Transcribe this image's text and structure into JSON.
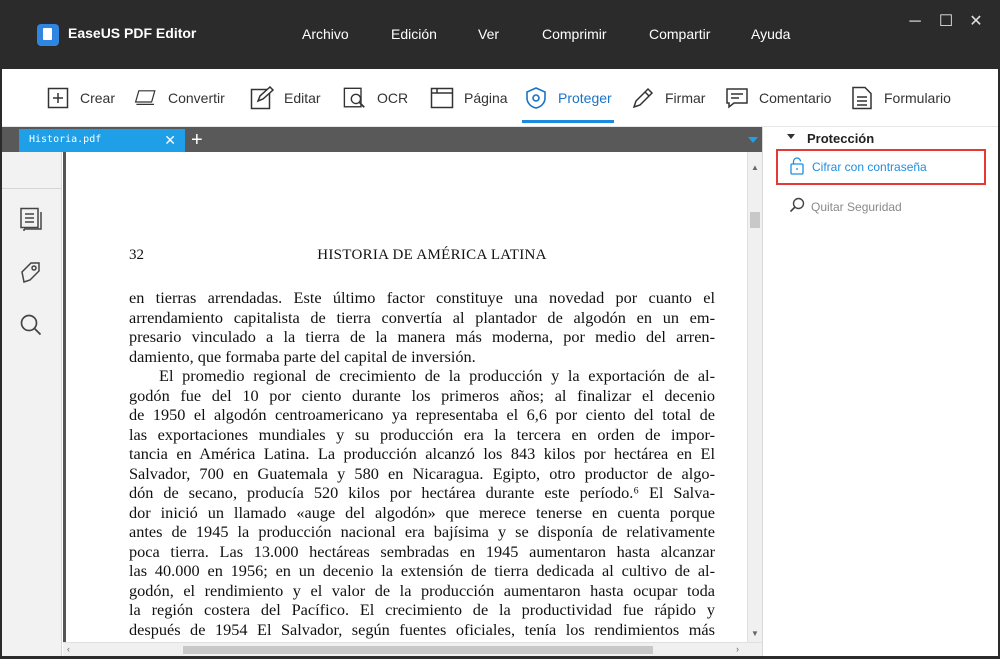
{
  "app": {
    "title": "EaseUS PDF Editor",
    "menu": [
      "Archivo",
      "Edición",
      "Ver",
      "Comprimir",
      "Compartir",
      "Ayuda"
    ],
    "window_controls": {
      "minimize": "─",
      "maximize": "☐",
      "close": "✕"
    }
  },
  "toolbar": {
    "items": [
      {
        "label": "Crear",
        "icon": "plus-box-icon"
      },
      {
        "label": "Convertir",
        "icon": "convert-icon"
      },
      {
        "label": "Editar",
        "icon": "edit-icon"
      },
      {
        "label": "OCR",
        "icon": "ocr-icon"
      },
      {
        "label": "Página",
        "icon": "page-icon"
      },
      {
        "label": "Proteger",
        "icon": "shield-icon",
        "active": true
      },
      {
        "label": "Firmar",
        "icon": "pen-icon"
      },
      {
        "label": "Comentario",
        "icon": "comment-icon"
      },
      {
        "label": "Formulario",
        "icon": "form-icon"
      }
    ],
    "accent_color": "#1a8be0"
  },
  "tabs": {
    "items": [
      {
        "label": "Historia.pdf",
        "close": "✕"
      }
    ],
    "new_tab": "+"
  },
  "left_rail": {
    "icons": [
      "thumbnails-icon",
      "bookmark-icon",
      "search-icon"
    ]
  },
  "document": {
    "page_number": "32",
    "running_head": "HISTORIA DE AMÉRICA LATINA",
    "lines": [
      "en tierras arrendadas. Este último factor constituye una novedad por cuanto el",
      "arrendamiento capitalista de tierra convertía al plantador de algodón en un em-",
      "presario vinculado a la tierra de la manera más moderna, por medio del arren-",
      "damiento, que formaba parte del capital de inversión.",
      "El promedio regional de crecimiento de la producción y la exportación de al-",
      "godón fue del 10 por ciento durante los primeros años; al finalizar el decenio",
      "de 1950 el algodón centroamericano ya representaba el 6,6 por ciento del total de",
      "las exportaciones mundiales y su producción era la tercera en orden de impor-",
      "tancia en América Latina. La producción alcanzó los 843 kilos por hectárea en El",
      "Salvador, 700 en Guatemala y 580 en Nicaragua. Egipto, otro productor de algo-",
      "dón de secano, producía 520 kilos por hectárea durante este período.⁶ El Salva-",
      "dor inició un llamado «auge del algodón» que merece tenerse en cuenta porque",
      "antes de 1945 la producción nacional era bajísima y se disponía de relativamente",
      "poca tierra. Las 13.000 hectáreas sembradas en 1945 aumentaron hasta alcanzar",
      "las 40.000 en 1956; en un decenio la extensión de tierra dedicada al cultivo de al-",
      "godón, el rendimiento y el valor de la producción aumentaron hasta ocupar toda",
      "la región costera del Pacífico. El crecimiento de la productividad fue rápido y",
      "después de 1954 El Salvador, según fuentes oficiales, tenía los rendimientos más"
    ]
  },
  "right_panel": {
    "section_title": "Protección",
    "items": [
      {
        "label": "Cifrar con contraseña",
        "icon": "lock-icon",
        "highlighted": true
      },
      {
        "label": "Quitar Seguridad",
        "icon": "search-icon"
      }
    ],
    "highlight_color": "#e53935"
  }
}
